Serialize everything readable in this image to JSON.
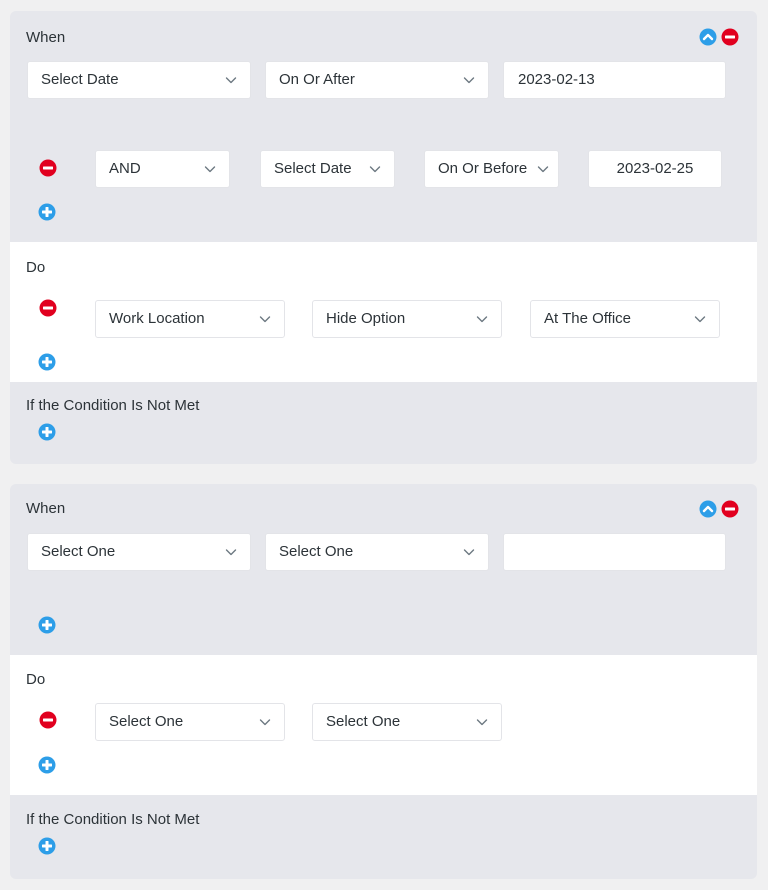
{
  "colors": {
    "accent": "#2d9ee8",
    "danger": "#e1001f",
    "panel": "#e6e7ec"
  },
  "blocks": [
    {
      "when": {
        "heading": "When",
        "row1": {
          "field": "Select Date",
          "operator": "On Or After",
          "value": "2023-02-13"
        },
        "row2": {
          "connector": "AND",
          "field": "Select Date",
          "operator": "On Or Before",
          "value": "2023-02-25"
        }
      },
      "do": {
        "heading": "Do",
        "field": "Work Location",
        "action": "Hide Option",
        "option": "At The Office"
      },
      "else": {
        "heading": "If the Condition Is Not Met"
      }
    },
    {
      "when": {
        "heading": "When",
        "row1": {
          "field": "Select One",
          "operator": "Select One",
          "value": ""
        }
      },
      "do": {
        "heading": "Do",
        "field": "Select One",
        "action": "Select One"
      },
      "else": {
        "heading": "If the Condition Is Not Met"
      }
    }
  ]
}
